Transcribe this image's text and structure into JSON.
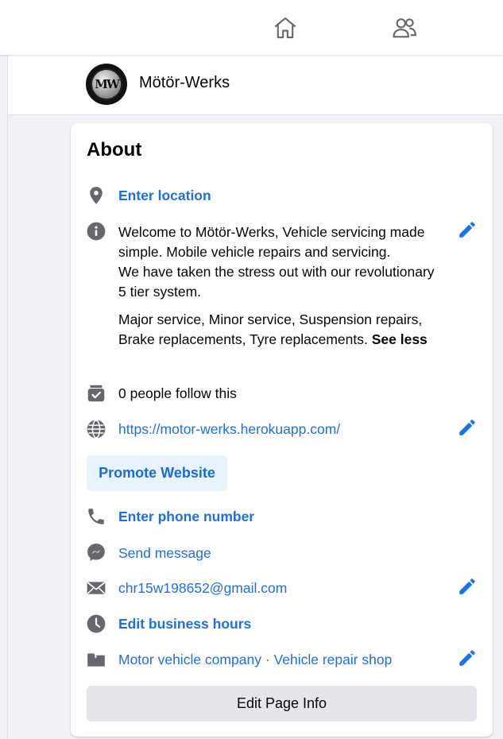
{
  "nav": {
    "icons": [
      "home-icon",
      "friends-icon"
    ]
  },
  "page": {
    "logo_text": "MW",
    "name": "Mötör-Werks"
  },
  "about": {
    "title": "About",
    "location": "Enter location",
    "description": {
      "line1": "Welcome to Mötör-Werks, Vehicle servicing made simple. Mobile vehicle repairs and servicing.",
      "line2": "We have taken the stress out with our revolutionary 5 tier system.",
      "paragraph2": "Major service, Minor service, Suspension repairs, Brake replacements, Tyre replacements.",
      "see_less": "See less"
    },
    "followers": "0 people follow this",
    "website": "https://motor-werks.herokuapp.com/",
    "promote_button": "Promote Website",
    "phone": "Enter phone number",
    "message": "Send message",
    "email": "chr15w198652@gmail.com",
    "hours": "Edit business hours",
    "category1": "Motor vehicle company",
    "category_separator": "·",
    "category2": "Vehicle repair shop",
    "edit_button": "Edit Page Info"
  },
  "colors": {
    "link": "#216fdb",
    "icon_gray": "#65676b",
    "button_light_blue": "#e7f3ff",
    "button_gray": "#e4e6eb"
  }
}
